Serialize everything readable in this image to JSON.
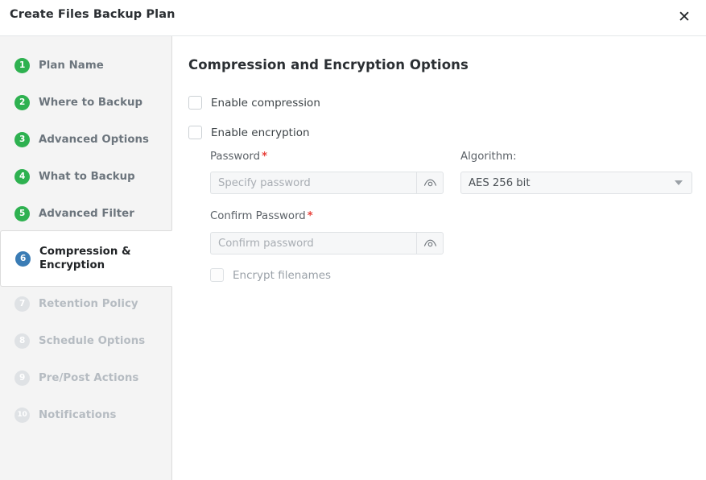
{
  "dialog": {
    "title": "Create Files Backup Plan",
    "close_icon": "close-icon"
  },
  "sidebar": {
    "steps": [
      {
        "number": "1",
        "label": "Plan Name",
        "state": "done"
      },
      {
        "number": "2",
        "label": "Where to Backup",
        "state": "done"
      },
      {
        "number": "3",
        "label": "Advanced Options",
        "state": "done"
      },
      {
        "number": "4",
        "label": "What to Backup",
        "state": "done"
      },
      {
        "number": "5",
        "label": "Advanced Filter",
        "state": "done"
      },
      {
        "number": "6",
        "label": "Compression &\nEncryption",
        "state": "active"
      },
      {
        "number": "7",
        "label": "Retention Policy",
        "state": "disabled"
      },
      {
        "number": "8",
        "label": "Schedule Options",
        "state": "disabled"
      },
      {
        "number": "9",
        "label": "Pre/Post Actions",
        "state": "disabled"
      },
      {
        "number": "10",
        "label": "Notifications",
        "state": "disabled"
      }
    ]
  },
  "main": {
    "heading": "Compression and Encryption Options",
    "enable_compression": {
      "label": "Enable compression",
      "checked": false
    },
    "enable_encryption": {
      "label": "Enable encryption",
      "checked": false
    },
    "password": {
      "label": "Password",
      "required_mark": "*",
      "placeholder": "Specify password",
      "value": "",
      "reveal_icon": "eye-icon"
    },
    "confirm_password": {
      "label": "Confirm Password",
      "required_mark": "*",
      "placeholder": "Confirm password",
      "value": "",
      "reveal_icon": "eye-icon"
    },
    "algorithm": {
      "label": "Algorithm:",
      "selected": "AES 256 bit",
      "caret_icon": "chevron-down-icon"
    },
    "encrypt_filenames": {
      "label": "Encrypt filenames",
      "checked": false,
      "disabled": true
    }
  },
  "colors": {
    "step_done": "#2eb150",
    "step_active": "#3a7cb5",
    "step_disabled": "#dfe2e5",
    "required": "#e8403a",
    "sidebar_bg": "#f4f4f4"
  }
}
